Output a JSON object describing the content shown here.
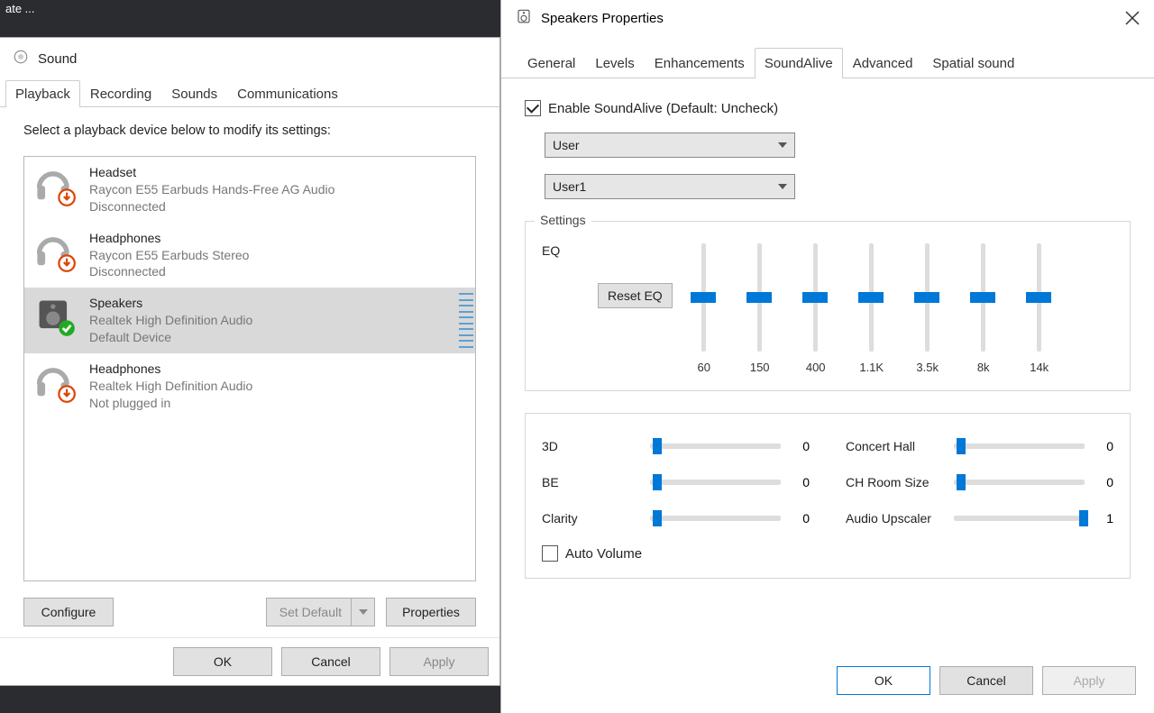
{
  "backdrop_text": "ate ...",
  "sound": {
    "title": "Sound",
    "tabs": [
      "Playback",
      "Recording",
      "Sounds",
      "Communications"
    ],
    "active_tab": 0,
    "instruction": "Select a playback device below to modify its settings:",
    "devices": [
      {
        "name": "Headset",
        "sub1": "Raycon E55 Earbuds Hands-Free AG Audio",
        "sub2": "Disconnected",
        "icon": "headset",
        "badge": "down"
      },
      {
        "name": "Headphones",
        "sub1": "Raycon E55 Earbuds Stereo",
        "sub2": "Disconnected",
        "icon": "headphones",
        "badge": "down"
      },
      {
        "name": "Speakers",
        "sub1": "Realtek High Definition Audio",
        "sub2": "Default Device",
        "icon": "speaker",
        "badge": "check",
        "selected": true
      },
      {
        "name": "Headphones",
        "sub1": "Realtek High Definition Audio",
        "sub2": "Not plugged in",
        "icon": "headphones",
        "badge": "down"
      }
    ],
    "configure": "Configure",
    "set_default": "Set Default",
    "properties": "Properties",
    "ok": "OK",
    "cancel": "Cancel",
    "apply": "Apply"
  },
  "props": {
    "title": "Speakers Properties",
    "tabs": [
      "General",
      "Levels",
      "Enhancements",
      "SoundAlive",
      "Advanced",
      "Spatial sound"
    ],
    "active_tab": 3,
    "enable_label": "Enable SoundAlive (Default: Uncheck)",
    "preset1": "User",
    "preset2": "User1",
    "settings_label": "Settings",
    "eq_label": "EQ",
    "reset_eq": "Reset EQ",
    "eq_bands": [
      "60",
      "150",
      "400",
      "1.1K",
      "3.5k",
      "8k",
      "14k"
    ],
    "effects_left": [
      {
        "label": "3D",
        "val": "0",
        "pos": 0.02
      },
      {
        "label": "BE",
        "val": "0",
        "pos": 0.02
      },
      {
        "label": "Clarity",
        "val": "0",
        "pos": 0.02
      }
    ],
    "effects_right": [
      {
        "label": "Concert Hall",
        "val": "0",
        "pos": 0.02
      },
      {
        "label": "CH Room Size",
        "val": "0",
        "pos": 0.02
      },
      {
        "label": "Audio Upscaler",
        "val": "1",
        "pos": 0.96
      }
    ],
    "auto_volume": "Auto Volume",
    "ok": "OK",
    "cancel": "Cancel",
    "apply": "Apply"
  }
}
